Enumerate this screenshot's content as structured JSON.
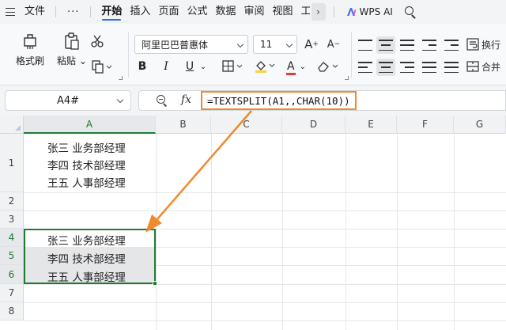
{
  "menubar": {
    "items": [
      "文件",
      "开始",
      "插入",
      "页面",
      "公式",
      "数据",
      "审阅",
      "视图",
      "工"
    ],
    "more": "···",
    "ai_label": "WPS AI"
  },
  "ribbon": {
    "format_painter": "格式刷",
    "paste": "粘贴",
    "font_name": "阿里巴巴普惠体",
    "font_size": "11",
    "bold": "B",
    "italic": "I",
    "underline": "U",
    "grow_font": "A",
    "shrink_font": "A",
    "font_color": "A",
    "wrap_text": "换行",
    "merge": "合并"
  },
  "formula_bar": {
    "name_box": "A4#",
    "fx": "fx",
    "formula": "=TEXTSPLIT(A1,,CHAR(10))"
  },
  "sheet": {
    "columns": [
      "A",
      "B",
      "C",
      "D",
      "E",
      "F",
      "G"
    ],
    "rows": [
      "1",
      "2",
      "3",
      "4",
      "5",
      "6",
      "7",
      "8"
    ],
    "a1_lines": [
      "张三 业务部经理",
      "李四 技术部经理",
      "王五 人事部经理"
    ],
    "a4": "张三 业务部经理",
    "a5": "李四 技术部经理",
    "a6": "王五 人事部经理"
  },
  "colors": {
    "accent_orange": "#ef8a2f",
    "selection_green": "#1e7b34",
    "tab_underline": "#2b6de8"
  }
}
